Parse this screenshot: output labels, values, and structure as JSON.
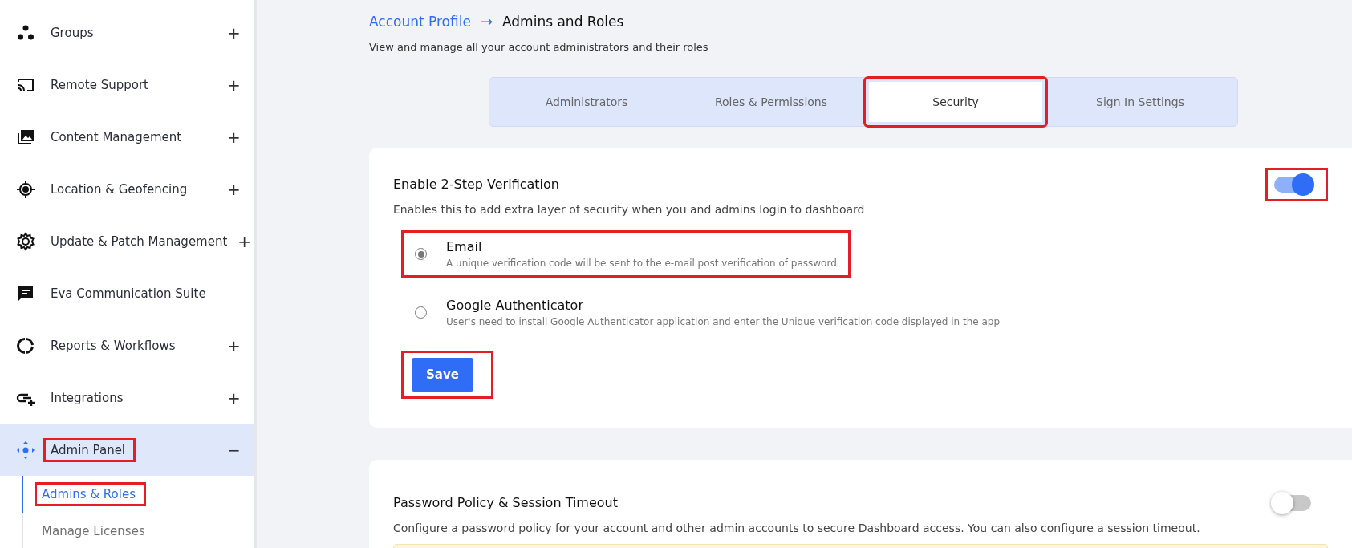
{
  "sidebar": {
    "items": [
      {
        "label": "Groups",
        "expander": "+",
        "expanded": false,
        "highlighted": false
      },
      {
        "label": "Remote Support",
        "expander": "+",
        "expanded": false,
        "highlighted": false
      },
      {
        "label": "Content Management",
        "expander": "+",
        "expanded": false,
        "highlighted": false
      },
      {
        "label": "Location & Geofencing",
        "expander": "+",
        "expanded": false,
        "highlighted": false
      },
      {
        "label": "Update & Patch Management",
        "expander": "+",
        "expanded": false,
        "highlighted": false
      },
      {
        "label": "Eva Communication Suite",
        "expanded": false,
        "highlighted": false
      },
      {
        "label": "Reports & Workflows",
        "expander": "+",
        "expanded": false,
        "highlighted": false
      },
      {
        "label": "Integrations",
        "expander": "+",
        "expanded": false,
        "highlighted": false
      },
      {
        "label": "Admin Panel",
        "expander": "−",
        "expanded": true,
        "highlighted": true,
        "children": [
          {
            "label": "Admins & Roles",
            "selected": true,
            "highlighted": true
          },
          {
            "label": "Manage Licenses",
            "selected": false,
            "highlighted": false
          }
        ]
      }
    ]
  },
  "breadcrumb": {
    "parent": "Account Profile",
    "separator": "→",
    "current": "Admins and Roles"
  },
  "subtitle": "View and manage all your account administrators and their roles",
  "tabs": [
    {
      "label": "Administrators",
      "selected": false,
      "highlighted": false
    },
    {
      "label": "Roles & Permissions",
      "selected": false,
      "highlighted": false
    },
    {
      "label": "Security",
      "selected": true,
      "highlighted": true
    },
    {
      "label": "Sign In Settings",
      "selected": false,
      "highlighted": false
    }
  ],
  "sections": [
    {
      "title": "Enable 2-Step Verification",
      "description": "Enables this to add extra layer of security when you and admins login to dashboard",
      "on": true,
      "toggle_highlighted": true,
      "options": [
        {
          "label": "Email",
          "description": "A unique verification code will be sent to the e-mail post verification of password",
          "selected": true,
          "highlighted": true
        },
        {
          "label": "Google Authenticator",
          "description": "User's need to install Google Authenticator application and enter the Unique verification code displayed in the app",
          "selected": false,
          "highlighted": false
        }
      ],
      "button": {
        "label": "Save",
        "highlighted": true
      }
    },
    {
      "title": "Password Policy & Session Timeout",
      "description": "Configure a password policy for your account and other admin accounts to secure Dashboard access. You can also configure a session timeout.",
      "on": false,
      "toggle_highlighted": false,
      "notice": true
    }
  ]
}
